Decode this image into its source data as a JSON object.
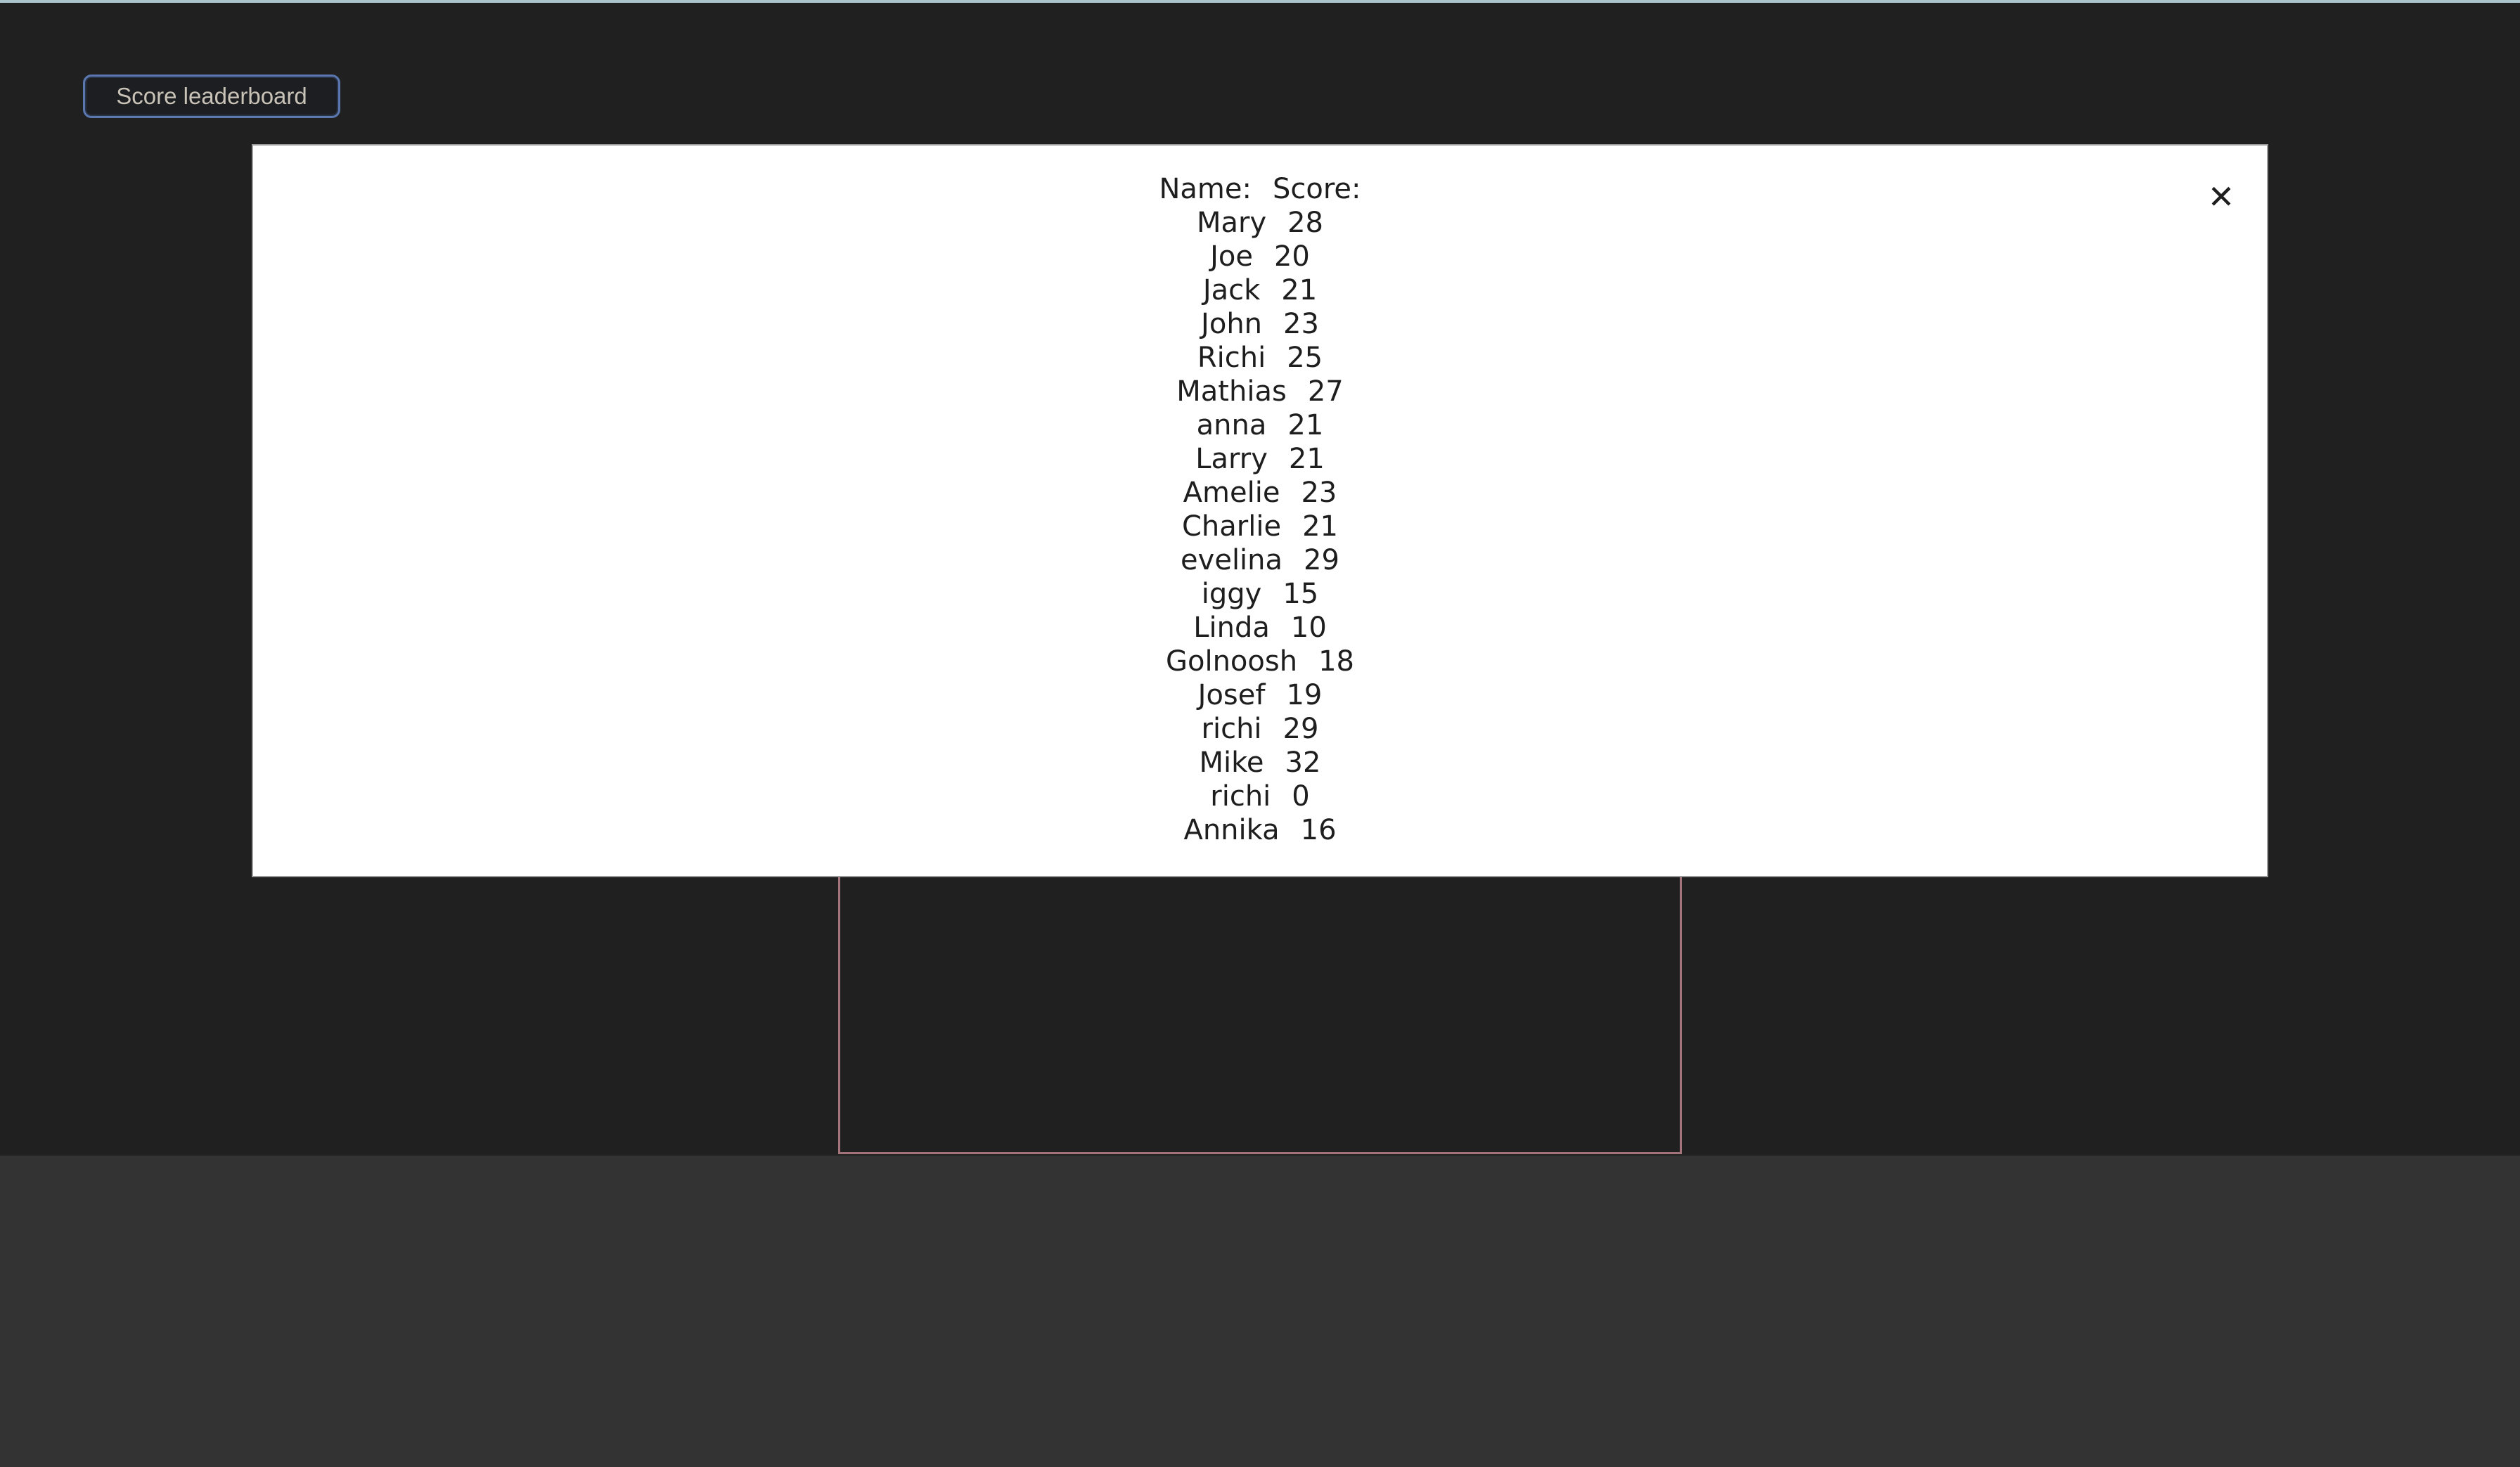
{
  "toolbar": {
    "leaderboard_button_label": "Score leaderboard"
  },
  "modal": {
    "close_icon": "close-icon",
    "close_glyph": "✕",
    "header": {
      "name_label": "Name:",
      "score_label": "Score:"
    },
    "entries": [
      {
        "name": "Mary",
        "score": "28"
      },
      {
        "name": "Joe",
        "score": "20"
      },
      {
        "name": "Jack",
        "score": "21"
      },
      {
        "name": "John",
        "score": "23"
      },
      {
        "name": "Richi",
        "score": "25"
      },
      {
        "name": "Mathias",
        "score": "27"
      },
      {
        "name": "anna",
        "score": "21"
      },
      {
        "name": "Larry",
        "score": "21"
      },
      {
        "name": "Amelie",
        "score": "23"
      },
      {
        "name": "Charlie",
        "score": "21"
      },
      {
        "name": "evelina",
        "score": "29"
      },
      {
        "name": "iggy",
        "score": "15"
      },
      {
        "name": "Linda",
        "score": "10"
      },
      {
        "name": "Golnoosh",
        "score": "18"
      },
      {
        "name": "Josef",
        "score": "19"
      },
      {
        "name": "richi",
        "score": "29"
      },
      {
        "name": "Mike",
        "score": "32"
      },
      {
        "name": "richi",
        "score": "0"
      },
      {
        "name": "Annika",
        "score": "16"
      }
    ]
  },
  "colors": {
    "page_background": "#202020",
    "lower_background": "#333333",
    "button_border": "#5a77b0",
    "canvas_border": "#a5737c",
    "modal_background": "#ffffff"
  }
}
